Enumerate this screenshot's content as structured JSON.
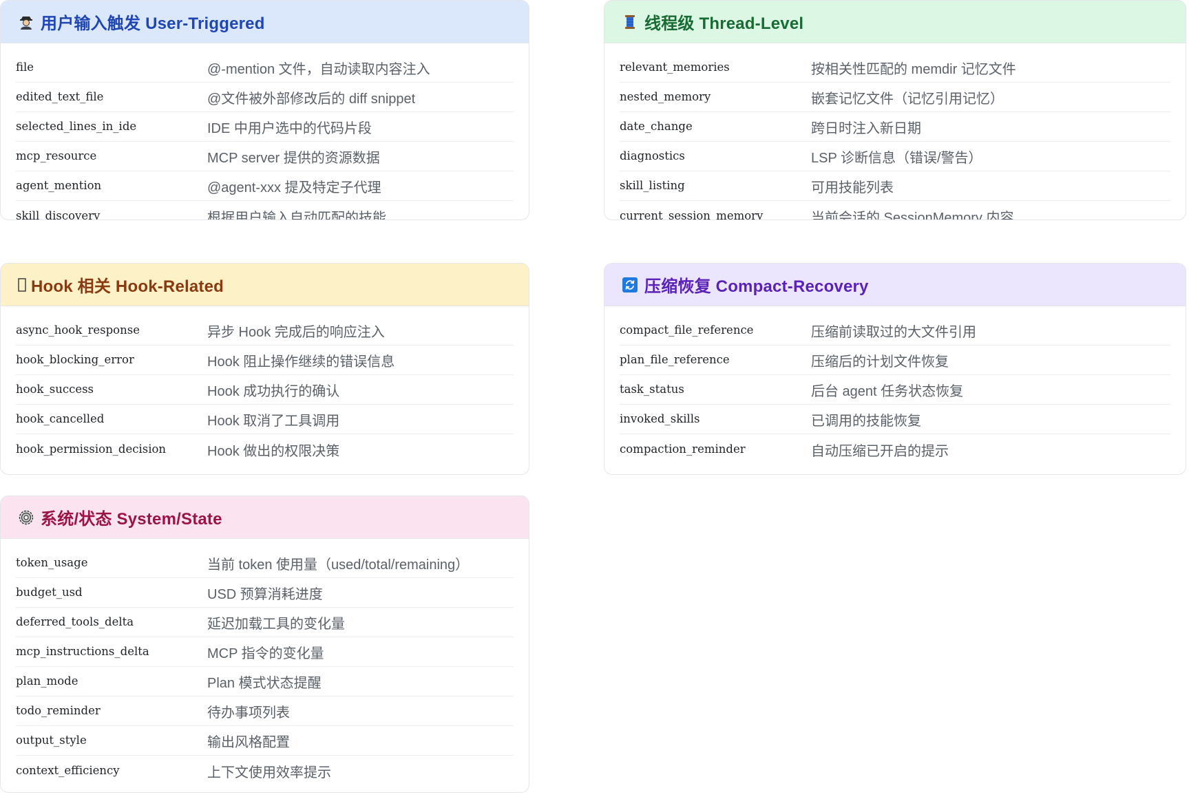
{
  "cards": [
    {
      "icon": "detective-icon",
      "title": "用户输入触发 User-Triggered",
      "rows": [
        {
          "key": "file",
          "desc": "@-mention 文件，自动读取内容注入"
        },
        {
          "key": "edited_text_file",
          "desc": "@文件被外部修改后的 diff snippet"
        },
        {
          "key": "selected_lines_in_ide",
          "desc": "IDE 中用户选中的代码片段"
        },
        {
          "key": "mcp_resource",
          "desc": "MCP server 提供的资源数据"
        },
        {
          "key": "agent_mention",
          "desc": "@agent-xxx 提及特定子代理"
        },
        {
          "key": "skill_discovery",
          "desc": "根据用户输入自动匹配的技能"
        }
      ]
    },
    {
      "icon": "thread-spool-icon",
      "title": "线程级 Thread-Level",
      "rows": [
        {
          "key": "relevant_memories",
          "desc": "按相关性匹配的 memdir 记忆文件"
        },
        {
          "key": "nested_memory",
          "desc": "嵌套记忆文件（记忆引用记忆）"
        },
        {
          "key": "date_change",
          "desc": "跨日时注入新日期"
        },
        {
          "key": "diagnostics",
          "desc": "LSP 诊断信息（错误/警告）"
        },
        {
          "key": "skill_listing",
          "desc": "可用技能列表"
        },
        {
          "key": "current_session_memory",
          "desc": "当前会话的 SessionMemory 内容"
        }
      ]
    },
    {
      "icon": "hook-icon",
      "title": "Hook 相关 Hook-Related",
      "rows": [
        {
          "key": "async_hook_response",
          "desc": "异步 Hook 完成后的响应注入"
        },
        {
          "key": "hook_blocking_error",
          "desc": "Hook 阻止操作继续的错误信息"
        },
        {
          "key": "hook_success",
          "desc": "Hook 成功执行的确认"
        },
        {
          "key": "hook_cancelled",
          "desc": "Hook 取消了工具调用"
        },
        {
          "key": "hook_permission_decision",
          "desc": "Hook 做出的权限决策"
        }
      ]
    },
    {
      "icon": "refresh-icon",
      "title": "压缩恢复 Compact-Recovery",
      "rows": [
        {
          "key": "compact_file_reference",
          "desc": "压缩前读取过的大文件引用"
        },
        {
          "key": "plan_file_reference",
          "desc": "压缩后的计划文件恢复"
        },
        {
          "key": "task_status",
          "desc": "后台 agent 任务状态恢复"
        },
        {
          "key": "invoked_skills",
          "desc": "已调用的技能恢复"
        },
        {
          "key": "compaction_reminder",
          "desc": "自动压缩已开启的提示"
        }
      ]
    },
    {
      "icon": "gear-icon",
      "title": "系统/状态 System/State",
      "rows": [
        {
          "key": "token_usage",
          "desc": "当前 token 使用量（used/total/remaining）"
        },
        {
          "key": "budget_usd",
          "desc": "USD 预算消耗进度"
        },
        {
          "key": "deferred_tools_delta",
          "desc": "延迟加载工具的变化量"
        },
        {
          "key": "mcp_instructions_delta",
          "desc": "MCP 指令的变化量"
        },
        {
          "key": "plan_mode",
          "desc": "Plan 模式状态提醒"
        },
        {
          "key": "todo_reminder",
          "desc": "待办事项列表"
        },
        {
          "key": "output_style",
          "desc": "输出风格配置"
        },
        {
          "key": "context_efficiency",
          "desc": "上下文使用效率提示"
        }
      ]
    }
  ]
}
